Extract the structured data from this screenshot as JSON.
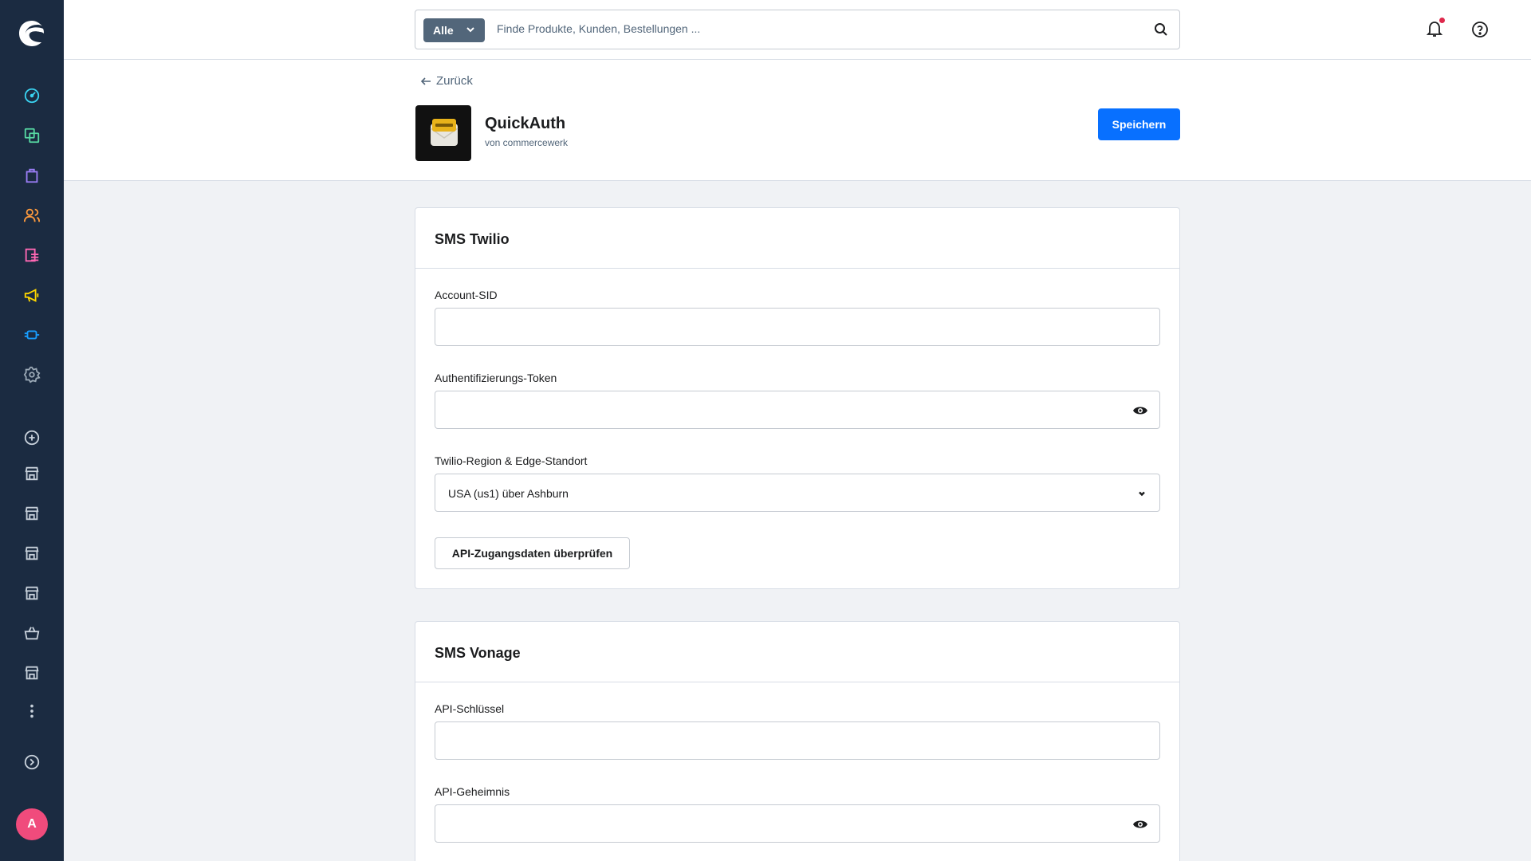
{
  "colors": {
    "sidebar_bg": "#1b2b41",
    "primary": "#0870ff",
    "avatar": "#f04b7c",
    "notification_dot": "#de294c"
  },
  "sidebar": {
    "nav_items": [
      {
        "icon": "dashboard-icon",
        "color": "#3ad2f0"
      },
      {
        "icon": "catalog-icon",
        "color": "#57d9a3"
      },
      {
        "icon": "orders-icon",
        "color": "#9b7ef6"
      },
      {
        "icon": "customers-icon",
        "color": "#ff9b3d"
      },
      {
        "icon": "content-icon",
        "color": "#ff68b4"
      },
      {
        "icon": "marketing-icon",
        "color": "#ffd700"
      },
      {
        "icon": "extensions-icon",
        "color": "#189eff"
      },
      {
        "icon": "settings-icon",
        "color": "#9aa8b5"
      }
    ],
    "sales_channels": [
      {
        "icon": "add-channel-icon"
      },
      {
        "icon": "storefront-icon"
      },
      {
        "icon": "storefront-icon"
      },
      {
        "icon": "storefront-icon"
      },
      {
        "icon": "storefront-icon"
      },
      {
        "icon": "basket-icon"
      },
      {
        "icon": "storefront-icon"
      }
    ],
    "avatar_initial": "A"
  },
  "search": {
    "filter_label": "Alle",
    "placeholder": "Finde Produkte, Kunden, Bestellungen ..."
  },
  "header": {
    "back_label": "Zurück",
    "app_name": "QuickAuth",
    "app_vendor": "von commercewerk",
    "save_label": "Speichern"
  },
  "cards": [
    {
      "title": "SMS Twilio",
      "fields": [
        {
          "label": "Account-SID",
          "value": ""
        },
        {
          "label": "Authentifizierungs-Token",
          "value": ""
        },
        {
          "label": "Twilio-Region & Edge-Standort",
          "value": "USA (us1) über Ashburn"
        }
      ],
      "button_label": "API-Zugangsdaten überprüfen"
    },
    {
      "title": "SMS Vonage",
      "fields": [
        {
          "label": "API-Schlüssel",
          "value": ""
        },
        {
          "label": "API-Geheimnis",
          "value": ""
        }
      ]
    }
  ]
}
